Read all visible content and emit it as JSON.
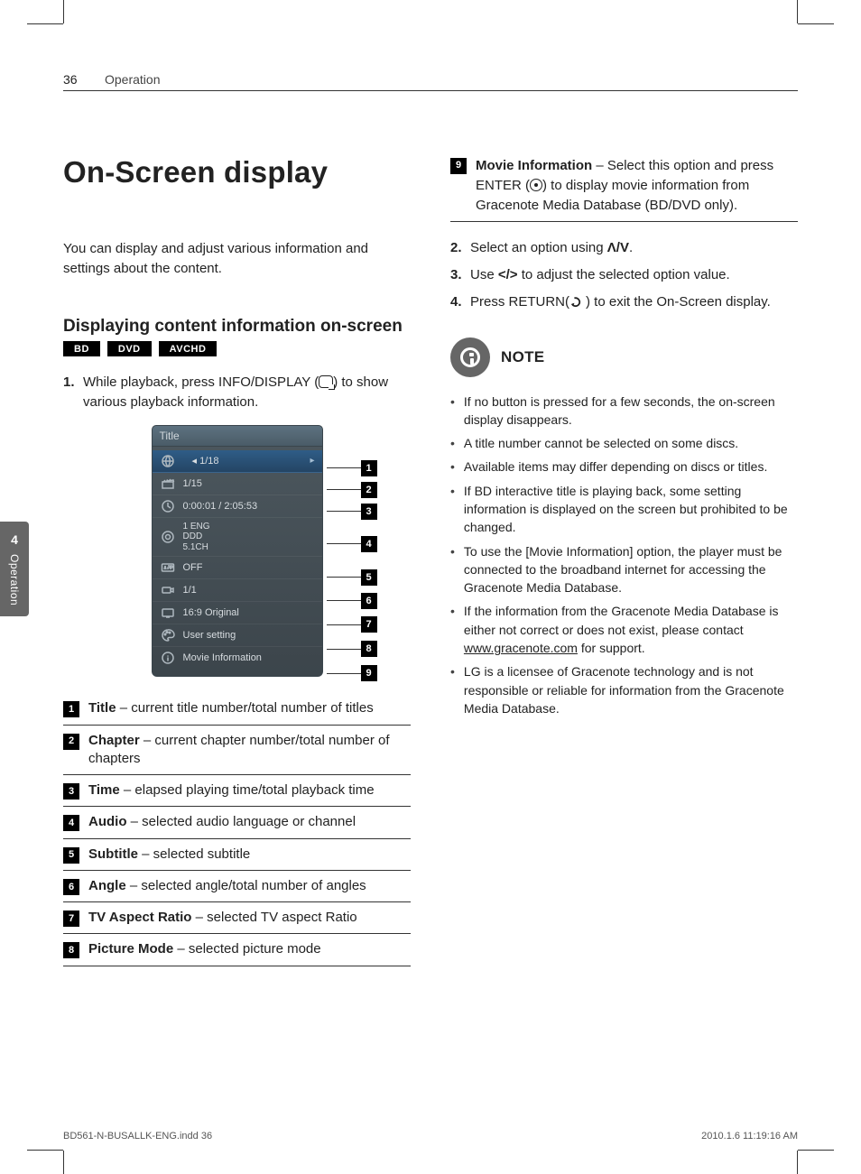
{
  "header": {
    "page_num": "36",
    "section": "Operation"
  },
  "side_tab": {
    "num": "4",
    "label": "Operation"
  },
  "main_title": "On-Screen display",
  "intro": "You can display and adjust various information and settings about the content.",
  "sub_heading": "Displaying content information on-screen",
  "badges": [
    "BD",
    "DVD",
    "AVCHD"
  ],
  "step1_a": "While playback, press INFO/DISPLAY (",
  "step1_b": ") to show various playback information.",
  "osd": {
    "header": "Title",
    "rows": [
      {
        "icon": "globe",
        "value": "◂ 1/18",
        "trailing_arrow": true,
        "selected": true
      },
      {
        "icon": "clapper",
        "value": "1/15"
      },
      {
        "icon": "clock",
        "value": "0:00:01 / 2:05:53"
      },
      {
        "icon": "target",
        "value": "1 ENG\nDDD\n5.1CH"
      },
      {
        "icon": "abc",
        "value": "OFF"
      },
      {
        "icon": "camera",
        "value": "1/1"
      },
      {
        "icon": "tv",
        "value": "16:9 Original"
      },
      {
        "icon": "palette",
        "value": "User setting"
      },
      {
        "icon": "info",
        "value": "Movie Information"
      }
    ]
  },
  "legend": [
    {
      "n": "1",
      "term": "Title",
      "desc": " – current title number/total number of titles"
    },
    {
      "n": "2",
      "term": "Chapter",
      "desc": " – current chapter number/total number of chapters"
    },
    {
      "n": "3",
      "term": "Time",
      "desc": " – elapsed playing time/total playback time"
    },
    {
      "n": "4",
      "term": "Audio",
      "desc": " – selected audio language or channel"
    },
    {
      "n": "5",
      "term": "Subtitle",
      "desc": " – selected subtitle"
    },
    {
      "n": "6",
      "term": "Angle",
      "desc": " – selected angle/total number of angles"
    },
    {
      "n": "7",
      "term": "TV Aspect Ratio",
      "desc": " – selected TV aspect Ratio"
    },
    {
      "n": "8",
      "term": "Picture Mode",
      "desc": " – selected picture mode"
    }
  ],
  "right_legend": {
    "n": "9",
    "term": "Movie Information",
    "desc_a": " – Select this option and press ENTER (",
    "desc_b": ") to display movie information from Gracenote Media Database (BD/DVD only)."
  },
  "steps_right": {
    "s2_a": "Select an option using ",
    "s2_sym": "Λ/V",
    "s2_b": ".",
    "s3_a": "Use ",
    "s3_sym": "</>",
    "s3_b": " to adjust the selected option value.",
    "s4_a": "Press RETURN(",
    "s4_b": ") to exit the On-Screen display."
  },
  "note_title": "NOTE",
  "notes": [
    "If no button is pressed for a few seconds, the on-screen display disappears.",
    "A title number cannot be selected on some discs.",
    "Available items may differ depending on discs or titles.",
    "If BD interactive title is playing back, some setting information is displayed on the screen but prohibited to be changed.",
    "To use the [Movie Information] option, the player must be connected to the broadband internet for accessing the Gracenote Media Database.",
    "If the information from the Gracenote Media Database is either not correct or does not exist, please contact www.gracenote.com for support.",
    "LG is a licensee of Gracenote technology and is not responsible or reliable for information from the Gracenote Media Database."
  ],
  "note_link_text": "www.gracenote.com",
  "footer": {
    "left": "BD561-N-BUSALLK-ENG.indd   36",
    "right": "2010.1.6   11:19:16 AM"
  }
}
